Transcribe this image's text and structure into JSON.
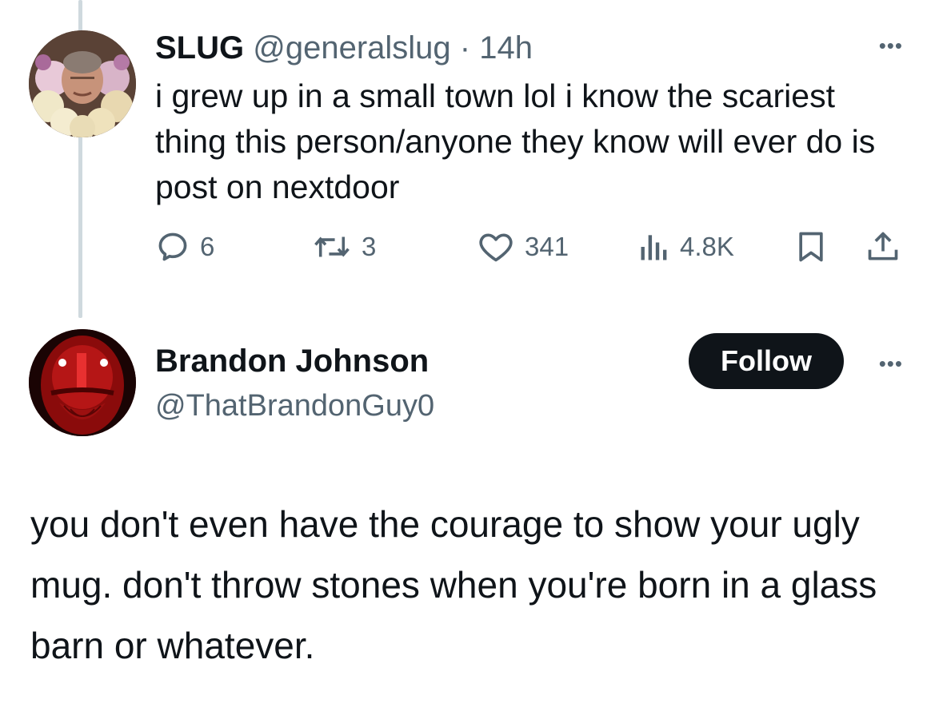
{
  "tweet1": {
    "display_name": "SLUG",
    "handle": "@generalslug",
    "separator": "·",
    "time": "14h",
    "text": "i grew up in a small town lol i know the scariest thing this person/anyone they know will ever do is post on nextdoor",
    "more_label": "•••",
    "actions": {
      "replies": "6",
      "reposts": "3",
      "likes": "341",
      "views": "4.8K"
    }
  },
  "tweet2": {
    "display_name": "Brandon Johnson",
    "handle": "@ThatBrandonGuy0",
    "follow_label": "Follow",
    "more_label": "•••",
    "text": "you don't even have the courage to show your ugly mug. don't throw stones when you're born in a glass barn or whatever."
  },
  "icons": {
    "reply": "reply-icon",
    "repost": "repost-icon",
    "like": "heart-icon",
    "views": "views-icon",
    "bookmark": "bookmark-icon",
    "share": "share-icon",
    "more": "more-icon"
  },
  "colors": {
    "text": "#0f1419",
    "secondary": "#536471",
    "thread_line": "#cfd9de",
    "follow_bg": "#0f1419"
  }
}
